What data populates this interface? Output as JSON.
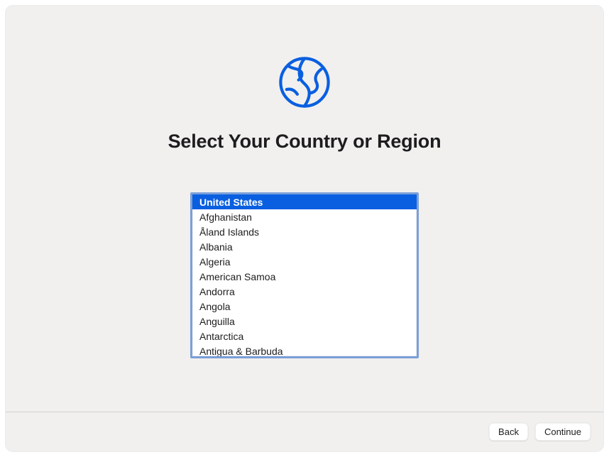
{
  "title": "Select Your Country or Region",
  "icon": "globe-icon",
  "accent_color": "#0a5fe0",
  "border_color": "#7a9fd8",
  "countries": [
    "United States",
    "Afghanistan",
    "Åland Islands",
    "Albania",
    "Algeria",
    "American Samoa",
    "Andorra",
    "Angola",
    "Anguilla",
    "Antarctica",
    "Antigua & Barbuda"
  ],
  "selected_index": 0,
  "buttons": {
    "back": "Back",
    "continue": "Continue"
  }
}
